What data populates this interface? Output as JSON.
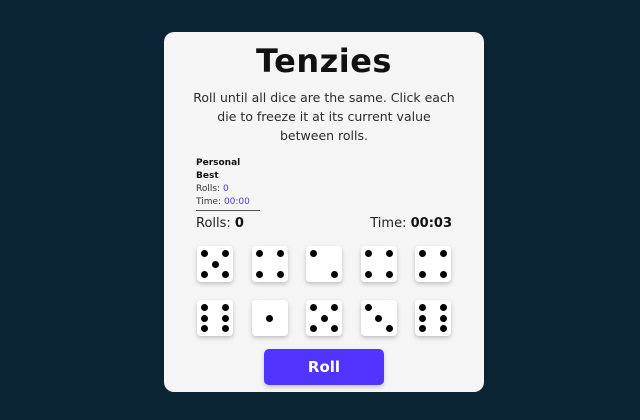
{
  "game": {
    "title": "Tenzies",
    "instructions": "Roll until all dice are the same. Click each die to freeze it at its current value between rolls."
  },
  "personal_best": {
    "heading": "Personal Best",
    "rolls_label": "Rolls:",
    "rolls_value": "0",
    "time_label": "Time:",
    "time_value": "00:00"
  },
  "stats": {
    "rolls_label": "Rolls:",
    "rolls_value": "0",
    "time_label": "Time:",
    "time_value": "00:03"
  },
  "dice": [
    5,
    4,
    2,
    4,
    4,
    6,
    1,
    5,
    3,
    6
  ],
  "roll_button": "Roll",
  "colors": {
    "background": "#0b2434",
    "card": "#f5f5f5",
    "accent": "#5035ff",
    "highlight_text": "#4b39ef"
  }
}
